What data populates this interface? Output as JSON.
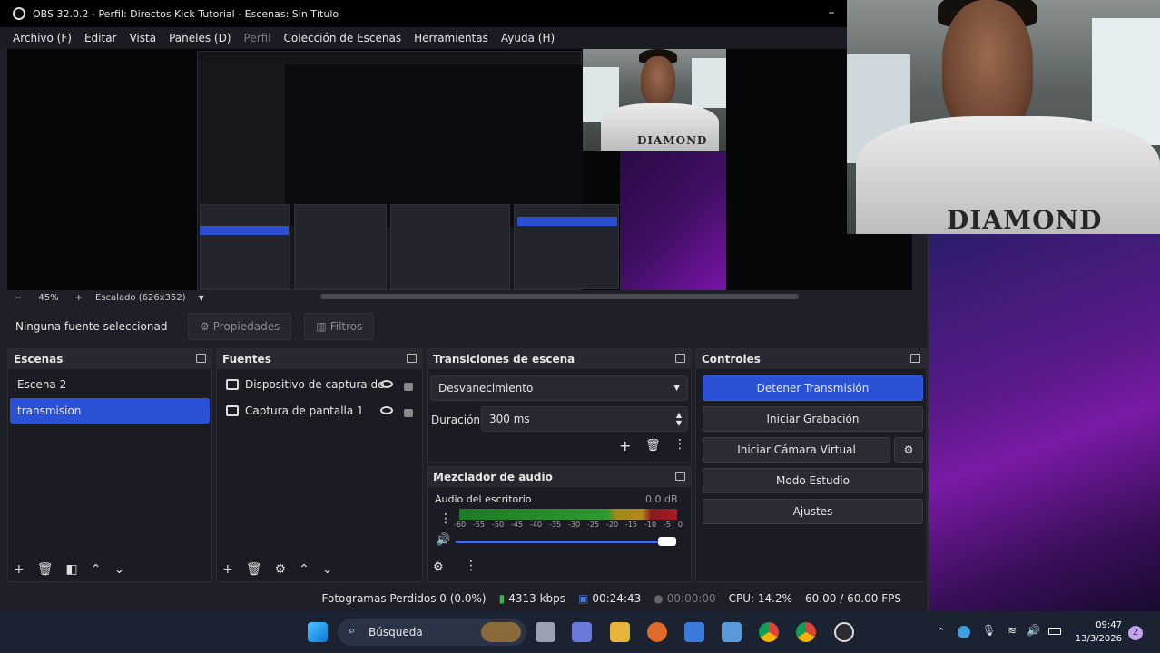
{
  "window": {
    "title": "OBS 32.0.2 - Perfil: Directos Kick Tutorial - Escenas: Sin Título",
    "minimize": "–"
  },
  "menu": [
    "Archivo (F)",
    "Editar",
    "Vista",
    "Paneles (D)",
    "Perfil",
    "Colección de Escenas",
    "Herramientas",
    "Ayuda (H)"
  ],
  "zoom": {
    "minus": "−",
    "value": "45%",
    "plus": "+",
    "scaled": "Escalado (626x352)",
    "caret": "▼"
  },
  "camera": {
    "brand": "DIAMOND"
  },
  "source_toolbar": {
    "no_selection": "Ninguna fuente seleccionad",
    "properties": "Propiedades",
    "filters": "Filtros"
  },
  "scenes": {
    "title": "Escenas",
    "items": [
      "Escena 2",
      "transmision"
    ],
    "selected": 1
  },
  "sources": {
    "title": "Fuentes",
    "items": [
      "Dispositivo de captura de",
      "Captura de pantalla 1"
    ]
  },
  "transitions": {
    "title": "Transiciones de escena",
    "type": "Desvanecimiento",
    "duration_label": "Duración",
    "duration_value": "300 ms"
  },
  "mixer": {
    "title": "Mezclador de audio",
    "track": "Audio del escritorio",
    "db": "0.0 dB",
    "scale": [
      "-60",
      "-55",
      "-50",
      "-45",
      "-40",
      "-35",
      "-30",
      "-25",
      "-20",
      "-15",
      "-10",
      "-5",
      "0"
    ],
    "volume_level": 0.97
  },
  "controls": {
    "title": "Controles",
    "stop_stream": "Detener Transmisión",
    "start_rec": "Iniciar Grabación",
    "virtual_cam": "Iniciar Cámara Virtual",
    "studio": "Modo Estudio",
    "settings": "Ajustes"
  },
  "status": {
    "dropped": "Fotogramas Perdidos 0 (0.0%)",
    "kbps": "4313 kbps",
    "stream_time": "00:24:43",
    "rec_time": "00:00:00",
    "cpu": "CPU: 14.2%",
    "fps": "60.00 / 60.00 FPS"
  },
  "taskbar": {
    "search": "Búsqueda",
    "time": "09:47",
    "date": "13/3/2026",
    "badge": "2"
  },
  "colors": {
    "accent": "#2b51d6",
    "bg": "#1e1f27",
    "panel": "#1b1c23"
  }
}
